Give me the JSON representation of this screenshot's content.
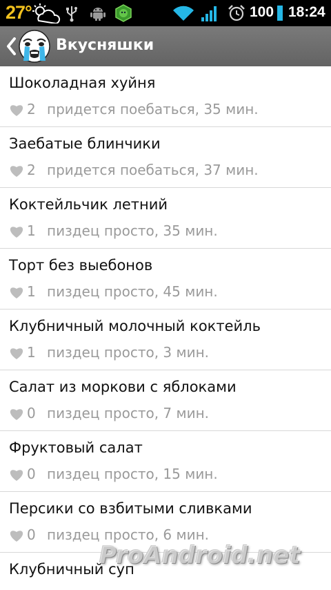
{
  "status_bar": {
    "temperature": "27°",
    "weather_icon": "partly-cloudy-icon",
    "usb_icon": "usb-icon",
    "android_icon": "android-debug-icon",
    "app_icon": "green-app-icon",
    "wifi_icon": "wifi-icon",
    "signal_icon": "signal-icon",
    "alarm_icon": "alarm-clock-icon",
    "battery": "100",
    "battery_color": "#25b7e6",
    "time": "18:24"
  },
  "action_bar": {
    "title": "Вкусняшки",
    "back_icon": "chevron-left-icon",
    "logo_icon": "crying-meme-face-icon"
  },
  "recipes": [
    {
      "title": "Шоколадная хуйня",
      "likes": "2",
      "meta": "придется поебаться, 35 мин."
    },
    {
      "title": "Заебатые блинчики",
      "likes": "2",
      "meta": "придется поебаться, 37 мин."
    },
    {
      "title": "Коктейльчик летний",
      "likes": "1",
      "meta": "пиздец просто, 35 мин."
    },
    {
      "title": "Торт без выебонов",
      "likes": "1",
      "meta": "пиздец просто, 45 мин."
    },
    {
      "title": "Клубничный молочный коктейль",
      "likes": "1",
      "meta": "пиздец просто, 3 мин."
    },
    {
      "title": "Салат из моркови с яблоками",
      "likes": "0",
      "meta": "пиздец просто, 7 мин."
    },
    {
      "title": "Фруктовый салат",
      "likes": "0",
      "meta": "пиздец просто, 15 мин."
    },
    {
      "title": "Персики со взбитыми сливками",
      "likes": "0",
      "meta": "пиздец просто, 6 мин."
    },
    {
      "title": "Клубничный суп",
      "likes": "",
      "meta": ""
    }
  ],
  "watermark": "ProAndroid.net"
}
